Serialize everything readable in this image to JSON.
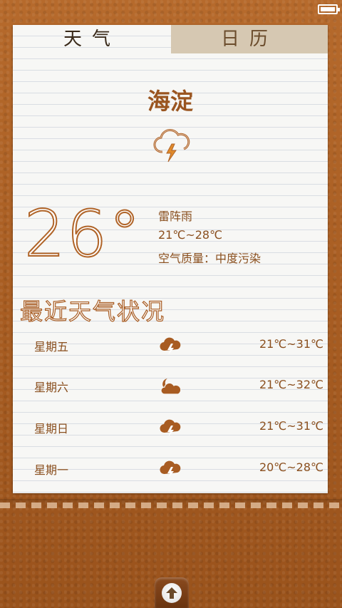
{
  "tabs": {
    "weather": "天气",
    "calendar": "日历"
  },
  "city": "海淀",
  "current": {
    "temperature": "26°",
    "condition": "雷阵雨",
    "range": "21℃~28℃",
    "air_quality": "空气质量：中度污染",
    "icon": "thunderstorm-icon"
  },
  "recent_title": "最近天气状况",
  "forecast": [
    {
      "day": "星期五",
      "range": "21℃~31℃",
      "icon": "thunderstorm-icon"
    },
    {
      "day": "星期六",
      "range": "21℃~32℃",
      "icon": "moon-cloud-icon"
    },
    {
      "day": "星期日",
      "range": "21℃~31℃",
      "icon": "thunderstorm-icon"
    },
    {
      "day": "星期一",
      "range": "20℃~28℃",
      "icon": "thunderstorm-icon"
    }
  ],
  "colors": {
    "accent": "#9a5520",
    "leather": "#a85d22",
    "paper": "#f7f7f5"
  }
}
